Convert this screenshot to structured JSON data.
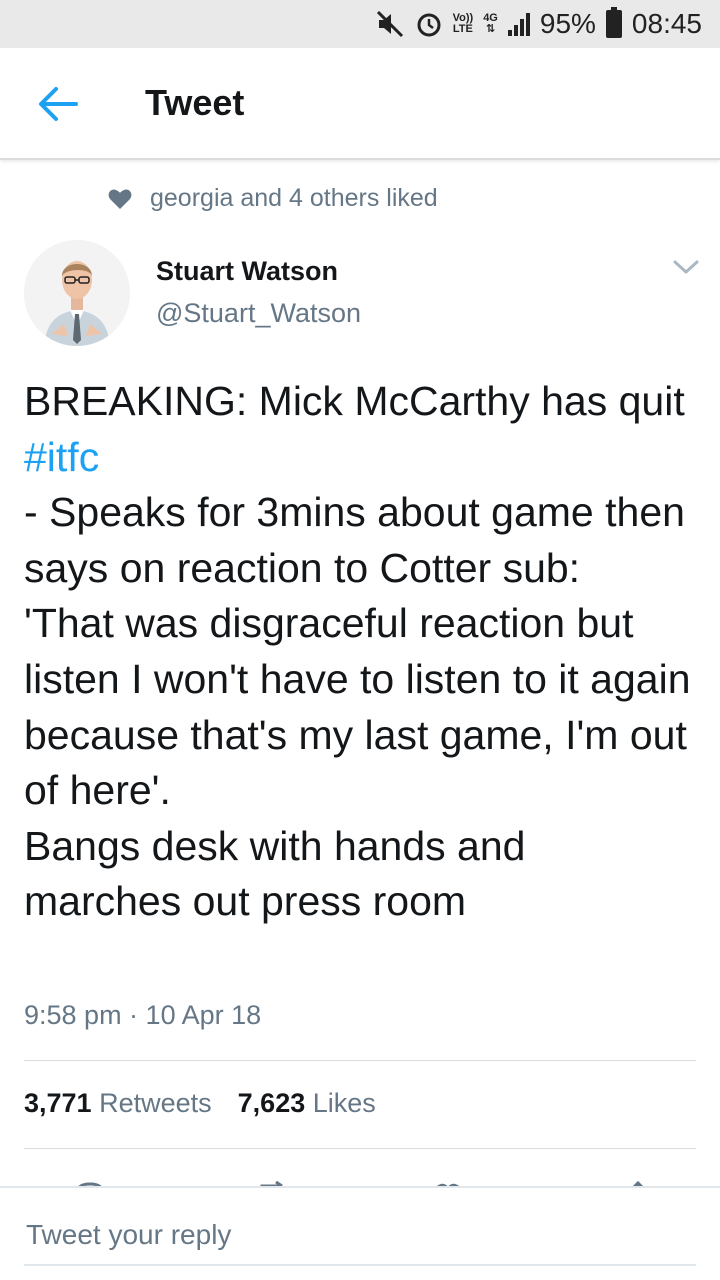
{
  "status_bar": {
    "volte": "Vo))",
    "lte": "LTE",
    "network": "4G",
    "battery": "95%",
    "time": "08:45"
  },
  "header": {
    "title": "Tweet"
  },
  "social_context": {
    "text": "georgia and 4 others liked"
  },
  "tweet": {
    "author_name": "Stuart Watson",
    "author_handle": "@Stuart_Watson",
    "text_before_tag": "BREAKING: Mick McCarthy has quit ",
    "hashtag": "#itfc",
    "text_after_tag": "\n- Speaks for 3mins about game then says on reaction to Cotter sub:\n'That was disgraceful reaction but listen I won't have to listen to it again because that's my last game, I'm out of here'.\nBangs desk with hands and marches out press room",
    "timestamp": "9:58 pm · 10 Apr 18"
  },
  "stats": {
    "retweets_count": "3,771",
    "retweets_label": "Retweets",
    "likes_count": "7,623",
    "likes_label": "Likes"
  },
  "reply": {
    "placeholder": "Tweet your reply"
  },
  "colors": {
    "accent": "#1da1f2",
    "secondary_text": "#657786",
    "primary_text": "#14171a"
  }
}
